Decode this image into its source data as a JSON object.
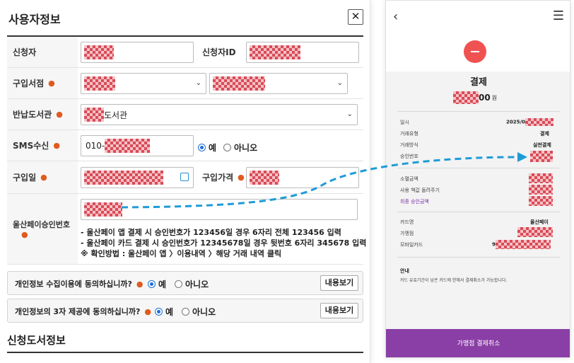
{
  "left": {
    "title": "사용자정보",
    "close": "✕",
    "applicant_label": "신청자",
    "applicant_id_label": "신청자ID",
    "store_label": "구입서점",
    "library_label": "반납도서관",
    "library_value": "도서관",
    "sms_label": "SMS수신",
    "sms_value": "010-",
    "yes": "예",
    "no": "아니오",
    "purchase_date_label": "구입일",
    "price_label": "구입가격",
    "approval_label": "울산페이승인번호",
    "notes": [
      "- 울산페이 앱 결제 시 승인번호가 123456일 경우 6자리 전체 123456 입력",
      "- 울산페이 카드 결제 시 승인번호가 12345678일 경우 뒷번호 6자리 345678 입력",
      "※ 확인방법 : 울산페이 앱 〉이용내역 〉해당 거래 내역 클릭"
    ],
    "agree1": "개인정보 수집이용에 동의하십니까?",
    "agree2": "개인정보의 3자 제공에 동의하십니까?",
    "view_btn": "내용보기",
    "section2": "신청도서정보"
  },
  "right": {
    "title": "결제",
    "amount_suffix": "00",
    "won": "원",
    "rows": [
      {
        "label": "일시",
        "value": "2025/0"
      },
      {
        "label": "거래유형",
        "value": "결제"
      },
      {
        "label": "거래방식",
        "value": "실판결제"
      },
      {
        "label": "승인번호",
        "value": ""
      }
    ],
    "rows2": [
      {
        "label": "소멸금액"
      },
      {
        "label": "사용 책값 돌려주기"
      },
      {
        "label": "최종 승인금액"
      }
    ],
    "rows3": [
      {
        "label": "카드명",
        "value": "울산페이"
      },
      {
        "label": "가맹점",
        "value": ""
      },
      {
        "label": "모바일카드",
        "value": "9"
      }
    ],
    "notice_title": "안내",
    "notice_body": "카드 유효기간이 남은 카드에 한해서 결제취소가 가능합니다.",
    "cancel_btn": "가맹점 결제취소"
  },
  "colors": {
    "accent_arrow": "#1e9bd7",
    "purple": "#8a3fa6",
    "red": "#f05252"
  }
}
